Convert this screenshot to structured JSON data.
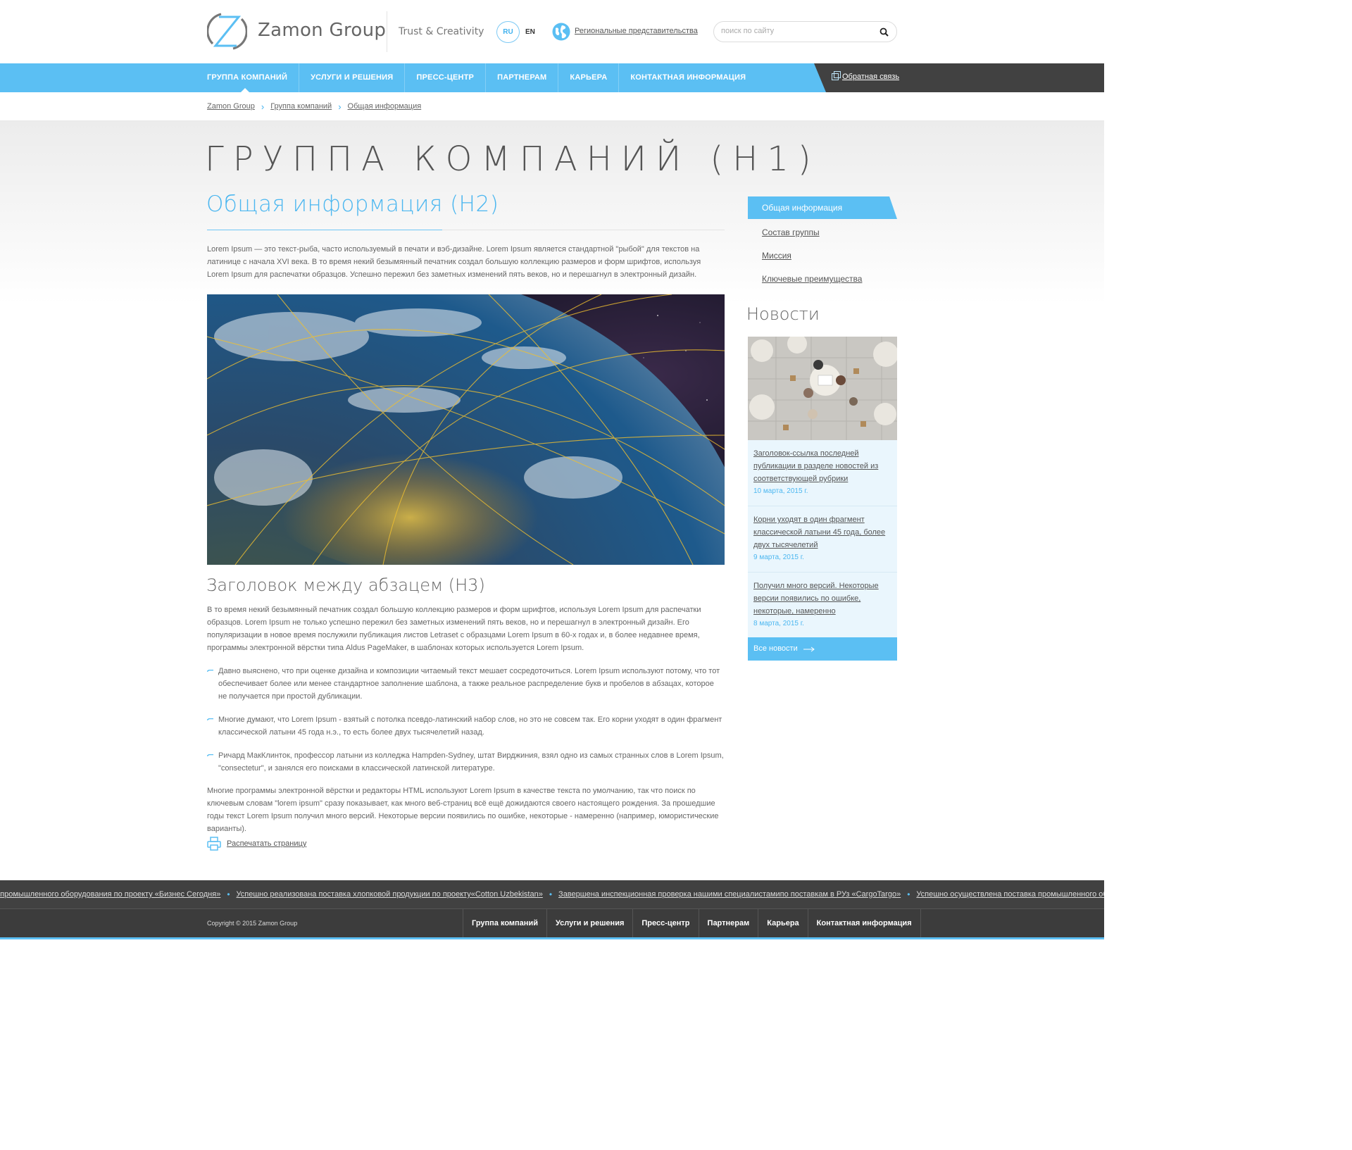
{
  "header": {
    "logo_text": "Zamon Group",
    "tagline": "Trust & Creativity",
    "lang_ru": "RU",
    "lang_en": "EN",
    "regional_link": "Региональные представительства",
    "search_placeholder": "поиск по сайту"
  },
  "nav": {
    "items": [
      {
        "label": "ГРУППА КОМПАНИЙ",
        "active": true
      },
      {
        "label": "УСЛУГИ И РЕШЕНИЯ"
      },
      {
        "label": "ПРЕСС-ЦЕНТР"
      },
      {
        "label": "ПАРТНЕРАМ"
      },
      {
        "label": "КАРЬЕРА"
      },
      {
        "label": "КОНТАКТНАЯ ИНФОРМАЦИЯ"
      }
    ],
    "feedback": "Обратная связь"
  },
  "breadcrumb": [
    "Zamon Group",
    "Группа компаний",
    "Общая информация"
  ],
  "main": {
    "h1": "ГРУППА КОМПАНИЙ (H1)",
    "h2": "Общая информация (H2)",
    "intro": "Lorem Ipsum — это текст-рыба, часто используемый в печати и вэб-дизайне. Lorem Ipsum является стандартной \"рыбой\" для текстов на латинице с начала XVI века. В то время некий безымянный печатник создал большую коллекцию размеров и форм шрифтов, используя Lorem Ipsum для распечатки образцов. Успешно пережил без заметных изменений пять веков, но и перешагнул в электронный дизайн.",
    "h3": "Заголовок между абзацем (H3)",
    "para2": "В то время некий безымянный печатник создал большую коллекцию размеров и форм шрифтов, используя Lorem Ipsum для распечатки образцов. Lorem Ipsum не только успешно пережил без заметных изменений пять веков, но и перешагнул в электронный дизайн. Его популяризации в новое время послужили публикация листов Letraset с образцами Lorem Ipsum в 60-х годах и, в более недавнее время, программы электронной вёрстки типа Aldus PageMaker, в шаблонах которых используется Lorem Ipsum.",
    "list": [
      "Давно выяснено, что при оценке дизайна и композиции читаемый текст мешает сосредоточиться. Lorem Ipsum используют потому, что тот обеспечивает более или менее стандартное заполнение шаблона, а также реальное распределение букв и пробелов в абзацах, которое не получается при простой дубликации.",
      "Многие думают, что Lorem Ipsum - взятый с потолка псевдо-латинский набор слов, но это не совсем так. Его корни уходят в один фрагмент классической латыни 45 года н.э., то есть более двух тысячелетий назад.",
      "Ричард МакКлинток, профессор латыни из колледжа Hampden-Sydney, штат Вирджиния, взял одно из самых странных слов в Lorem Ipsum, \"consectetur\", и занялся его поисками в классической латинской литературе."
    ],
    "para3": "Многие программы электронной вёрстки и редакторы HTML используют Lorem Ipsum в качестве текста по умолчанию, так что поиск по ключевым словам \"lorem ipsum\" сразу показывает, как много веб-страниц всё ещё дожидаются своего настоящего рождения. За прошедшие годы текст Lorem Ipsum получил много версий. Некоторые версии появились по ошибке, некоторые - намеренно (например, юмористические варианты).",
    "print": "Распечатать страницу"
  },
  "sidebar": {
    "menu": [
      "Общая информация",
      "Состав группы",
      "Миссия",
      "Ключевые преимущества"
    ],
    "news_title": "Новости",
    "news": [
      {
        "title": "Заголовок-ссылка последней публикации в разделе новостей из соответствующей рубрики",
        "date": "10 марта, 2015 г."
      },
      {
        "title": "Корни уходят в один фрагмент классической латыни 45 года, более двух тысячелетий",
        "date": "9 марта, 2015 г."
      },
      {
        "title": "Получил много версий. Некоторые версии появились по ошибке, некоторые, намеренно",
        "date": "8 марта, 2015 г."
      }
    ],
    "all_news": "Все новости"
  },
  "ticker": [
    "а промышленного оборудования по проекту «Бизнес Сегодня»",
    "Успешно реализована поставка хлопковой продукции по проекту«Cotton Uzbekistan»",
    "Завершена инспекционная проверка нашими специалистамипо поставкам в РУз «CargoTargo»",
    "Успешно осуществлена поставка промышленного оборудова"
  ],
  "footer": {
    "copyright": "Copyright © 2015 Zamon Group",
    "nav": [
      "Группа компаний",
      "Услуги и решения",
      "Пресс-центр",
      "Партнерам",
      "Карьера",
      "Контактная информация"
    ]
  },
  "colors": {
    "accent": "#5bbff3",
    "dark": "#414141"
  }
}
